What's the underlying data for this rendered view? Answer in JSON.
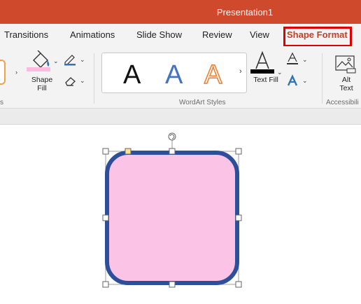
{
  "title": "Presentation1",
  "tabs": [
    "Transitions",
    "Animations",
    "Slide Show",
    "Review",
    "View",
    "Shape Format"
  ],
  "ribbon": {
    "shape_fill_label_1": "Shape",
    "shape_fill_label_2": "Fill",
    "left_group_tail": "s",
    "wordart_letters": [
      "A",
      "A",
      "A"
    ],
    "wordart_group_label": "WordArt Styles",
    "text_fill_label": "Text Fill",
    "alt_text_label_1": "Alt",
    "alt_text_label_2": "Text",
    "accessibility_label": "Accessibili"
  },
  "colors": {
    "accent": "#cf4a2c",
    "shape_fill_swatch": "#fdbbe0",
    "shape_fill": "#fbc3e6",
    "shape_outline": "#2d4f9a",
    "wordart_blue": "#4472c4",
    "wordart_orange": "#ed7d31"
  }
}
